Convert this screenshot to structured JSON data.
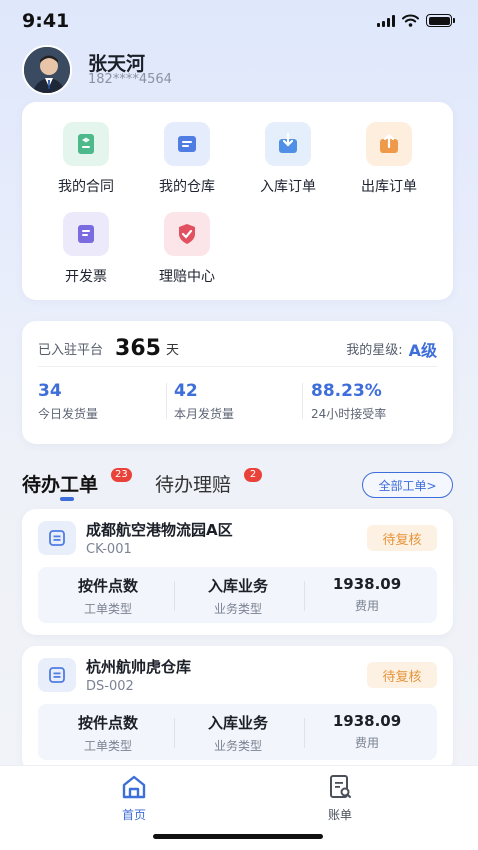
{
  "status_bar": {
    "time": "9:41"
  },
  "profile": {
    "name": "张天河",
    "phone": "182****4564"
  },
  "shortcuts": [
    {
      "label": "我的合同",
      "icon": "contract-icon",
      "color": "#4cb98a",
      "bg": "#e3f5ec"
    },
    {
      "label": "我的仓库",
      "icon": "warehouse-icon",
      "color": "#4f7de3",
      "bg": "#e5ecfb"
    },
    {
      "label": "入库订单",
      "icon": "inbound-order-icon",
      "color": "#4f8fe6",
      "bg": "#e5eefb"
    },
    {
      "label": "出库订单",
      "icon": "outbound-order-icon",
      "color": "#ef9a4a",
      "bg": "#fdeedd"
    },
    {
      "label": "开发票",
      "icon": "invoice-icon",
      "color": "#7b6be0",
      "bg": "#ece9fb"
    },
    {
      "label": "理赔中心",
      "icon": "claims-icon",
      "color": "#e2515f",
      "bg": "#fbe5e8"
    }
  ],
  "stats": {
    "joined_label": "已入驻平台",
    "days": "365",
    "days_unit": "天",
    "level_label": "我的星级:",
    "level": "A级",
    "items": [
      {
        "value": "34",
        "label": "今日发货量"
      },
      {
        "value": "42",
        "label": "本月发货量"
      },
      {
        "value": "88.23%",
        "label": "24小时接受率"
      }
    ]
  },
  "tabs": [
    {
      "label": "待办工单",
      "badge": "23",
      "active": true
    },
    {
      "label": "待办理赔",
      "badge": "2",
      "active": false
    }
  ],
  "all_orders_button": "全部工单>",
  "orders": [
    {
      "warehouse": "成都航空港物流园A区",
      "code": "CK-001",
      "status": "待复核",
      "fields": [
        {
          "value": "按件点数",
          "label": "工单类型"
        },
        {
          "value": "入库业务",
          "label": "业务类型"
        },
        {
          "value": "1938.09",
          "label": "费用"
        }
      ]
    },
    {
      "warehouse": "杭州航帅虎仓库",
      "code": "DS-002",
      "status": "待复核",
      "fields": [
        {
          "value": "按件点数",
          "label": "工单类型"
        },
        {
          "value": "入库业务",
          "label": "业务类型"
        },
        {
          "value": "1938.09",
          "label": "费用"
        }
      ]
    }
  ],
  "bottom_nav": [
    {
      "label": "首页",
      "icon": "home-icon",
      "active": true
    },
    {
      "label": "账单",
      "icon": "bill-icon",
      "active": false
    }
  ],
  "colors": {
    "accent": "#3d6ed9",
    "badge": "#e8423a",
    "status_tag": "#e79337"
  }
}
